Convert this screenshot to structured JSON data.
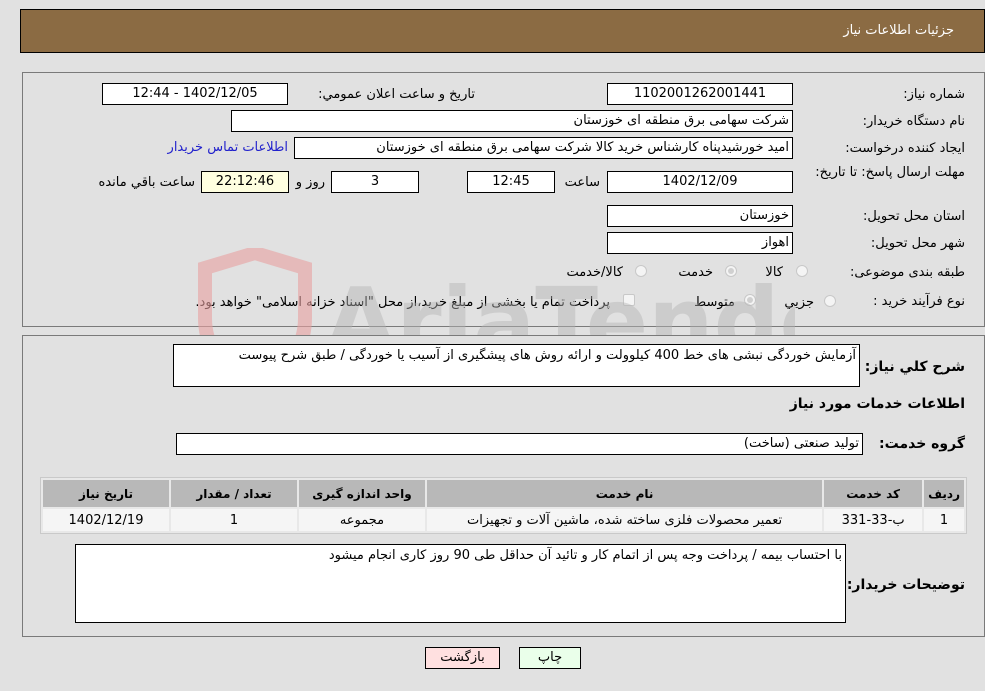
{
  "header": {
    "title": "جزئیات اطلاعات نیاز"
  },
  "form": {
    "need_number": {
      "label": "شماره نیاز:",
      "value": "1102001262001441"
    },
    "announce_datetime": {
      "label": "تاريخ و ساعت اعلان عمومي:",
      "value": "1402/12/05 - 12:44"
    },
    "buyer_org": {
      "label": "نام دستگاه خريدار:",
      "value": "شرکت سهامی برق منطقه ای خوزستان"
    },
    "requester": {
      "label": "ايجاد کننده درخواست:",
      "value": "امید خورشیدپناه کارشناس خرید کالا شرکت سهامی برق منطقه ای خوزستان"
    },
    "buyer_contact_link": "اطلاعات تماس خريدار",
    "deadline": {
      "label": "مهلت ارسال پاسخ: تا تاريخ:",
      "date": "1402/12/09",
      "time_label": "ساعت",
      "time": "12:45",
      "days": "3",
      "days_label": "روز و",
      "remaining": "22:12:46",
      "remaining_label": "ساعت باقي مانده"
    },
    "province": {
      "label": "استان محل تحويل:",
      "value": "خوزستان"
    },
    "city": {
      "label": "شهر محل تحويل:",
      "value": "اهواز"
    },
    "category": {
      "label": "طبقه بندی موضوعی:",
      "options": [
        {
          "label": "کالا",
          "selected": false
        },
        {
          "label": "خدمت",
          "selected": true
        },
        {
          "label": "کالا/خدمت",
          "selected": false
        }
      ]
    },
    "purchase_type": {
      "label": "نوع فرآيند خريد :",
      "options": [
        {
          "label": "جزيي",
          "selected": false
        },
        {
          "label": "متوسط",
          "selected": true
        }
      ],
      "treasury_checkbox_label": "پرداخت تمام يا بخشی از مبلغ خريد،از محل \"اسناد خزانه اسلامی\" خواهد بود.",
      "treasury_checked": false
    }
  },
  "description": {
    "label": "شرح کلي نياز:",
    "value": "آزمایش خوردگی نبشی های خط 400 کیلوولت و ارائه روش های پیشگیری از آسیب یا خوردگی / طبق شرح پیوست"
  },
  "services": {
    "section_title": "اطلاعات خدمات مورد نياز",
    "group_label": "گروه خدمت:",
    "group_value": "تولید صنعتی (ساخت)",
    "table": {
      "headers": [
        "رديف",
        "کد خدمت",
        "نام خدمت",
        "واحد اندازه گيری",
        "تعداد / مقدار",
        "تاريخ نياز"
      ],
      "rows": [
        [
          "1",
          "ب-33-331",
          "تعمیر محصولات فلزی ساخته شده، ماشین آلات و تجهیزات",
          "مجموعه",
          "1",
          "1402/12/19"
        ]
      ]
    }
  },
  "buyer_notes": {
    "label": "توضيحات خريدار:",
    "value": "با احتساب بیمه / پرداخت وجه پس از اتمام کار و تائید آن حداقل طی 90 روز کاری انجام میشود"
  },
  "buttons": {
    "print": "چاپ",
    "back": "بازگشت"
  },
  "watermark": {
    "text": "AriaTender.neT"
  },
  "colors": {
    "header_bg": "#8b6b43",
    "print_bg": "#eaffea",
    "back_bg": "#ffe0e0",
    "link": "#2222cc"
  }
}
